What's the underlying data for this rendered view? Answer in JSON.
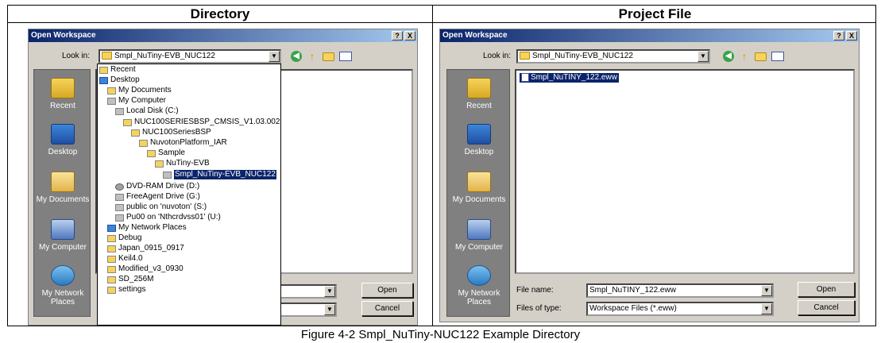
{
  "headers": {
    "left": "Directory",
    "right": "Project File"
  },
  "caption": "Figure 4-2 Smpl_NuTiny-NUC122 Example Directory",
  "dialog": {
    "title": "Open Workspace",
    "help_btn": "?",
    "close_btn": "X",
    "look_in_label": "Look in:",
    "look_in_value": "Smpl_NuTiny-EVB_NUC122",
    "places": [
      "Recent",
      "Desktop",
      "My Documents",
      "My Computer",
      "My Network Places"
    ],
    "file_name_label": "File name:",
    "file_type_label": "Files of type:",
    "open_btn": "Open",
    "cancel_btn": "Cancel"
  },
  "left_dropdown": [
    "Recent",
    "Desktop",
    "My Documents",
    "My Computer",
    "Local Disk (C:)",
    "NUC100SERIESBSP_CMSIS_V1.03.002",
    "NUC100SeriesBSP",
    "NuvotonPlatform_IAR",
    "Sample",
    "NuTiny-EVB",
    "Smpl_NuTiny-EVB_NUC122",
    "DVD-RAM Drive (D:)",
    "FreeAgent Drive (G:)",
    "public on 'nuvoton' (S:)",
    "Pu00 on 'Nthcrdvss01' (U:)",
    "My Network Places",
    "Debug",
    "Japan_0915_0917",
    "Keil4.0",
    "Modified_v3_0930",
    "SD_256M",
    "settings"
  ],
  "right_files": [
    "Smpl_NuTINY_122.eww"
  ],
  "right_fields": {
    "file_name_value": "Smpl_NuTINY_122.eww",
    "file_type_value": "Workspace Files (*.eww)"
  }
}
